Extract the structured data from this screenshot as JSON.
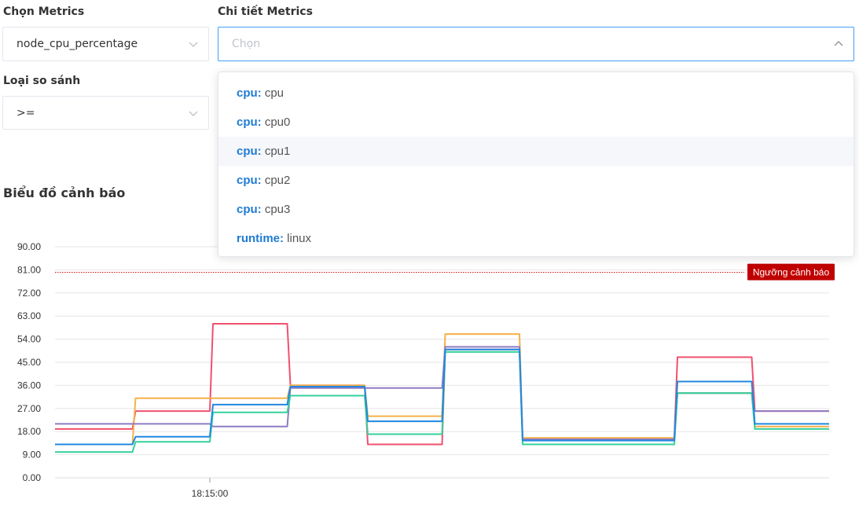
{
  "form": {
    "metric_label": "Chọn Metrics",
    "metric_value": "node_cpu_percentage",
    "detail_label": "Chi tiết Metrics",
    "detail_placeholder": "Chọn",
    "compare_label": "Loại so sánh",
    "compare_value": ">="
  },
  "dropdown": {
    "options": [
      {
        "key": "cpu:",
        "value": "cpu"
      },
      {
        "key": "cpu:",
        "value": "cpu0"
      },
      {
        "key": "cpu:",
        "value": "cpu1"
      },
      {
        "key": "cpu:",
        "value": "cpu2"
      },
      {
        "key": "cpu:",
        "value": "cpu3"
      },
      {
        "key": "runtime:",
        "value": "linux"
      }
    ],
    "hovered_index": 2
  },
  "chart_section": {
    "title": "Biểu đồ cảnh báo"
  },
  "chart_data": {
    "type": "line",
    "title": "",
    "xlabel": "",
    "ylabel": "",
    "ylim": [
      0,
      90
    ],
    "y_ticks": [
      "0.00",
      "9.00",
      "18.00",
      "27.00",
      "36.00",
      "45.00",
      "54.00",
      "63.00",
      "72.00",
      "81.00",
      "90.00"
    ],
    "x_ticks": [
      {
        "label": "18:15:00",
        "index": 2
      }
    ],
    "grid": true,
    "threshold": {
      "value": 80,
      "label": "Ngưỡng cảnh báo",
      "color": "#cc0000"
    },
    "x_segments": 10,
    "series": [
      {
        "color": "#f0506e",
        "values": [
          19,
          26,
          60,
          36,
          13,
          50,
          15.5,
          15.5,
          47,
          26
        ]
      },
      {
        "color": "#f5b14a",
        "values": [
          13,
          31,
          31,
          36,
          24,
          56,
          15.5,
          15.5,
          33,
          20
        ]
      },
      {
        "color": "#8e7cc3",
        "values": [
          21,
          21,
          20,
          35,
          35,
          51,
          15,
          15,
          33,
          26
        ]
      },
      {
        "color": "#34d19a",
        "values": [
          10,
          14,
          25.5,
          32,
          17,
          49,
          13,
          13,
          33,
          19
        ]
      },
      {
        "color": "#2188e0",
        "values": [
          13,
          16,
          28.5,
          35.5,
          22,
          50,
          14.5,
          14.5,
          37.5,
          21
        ]
      }
    ]
  }
}
